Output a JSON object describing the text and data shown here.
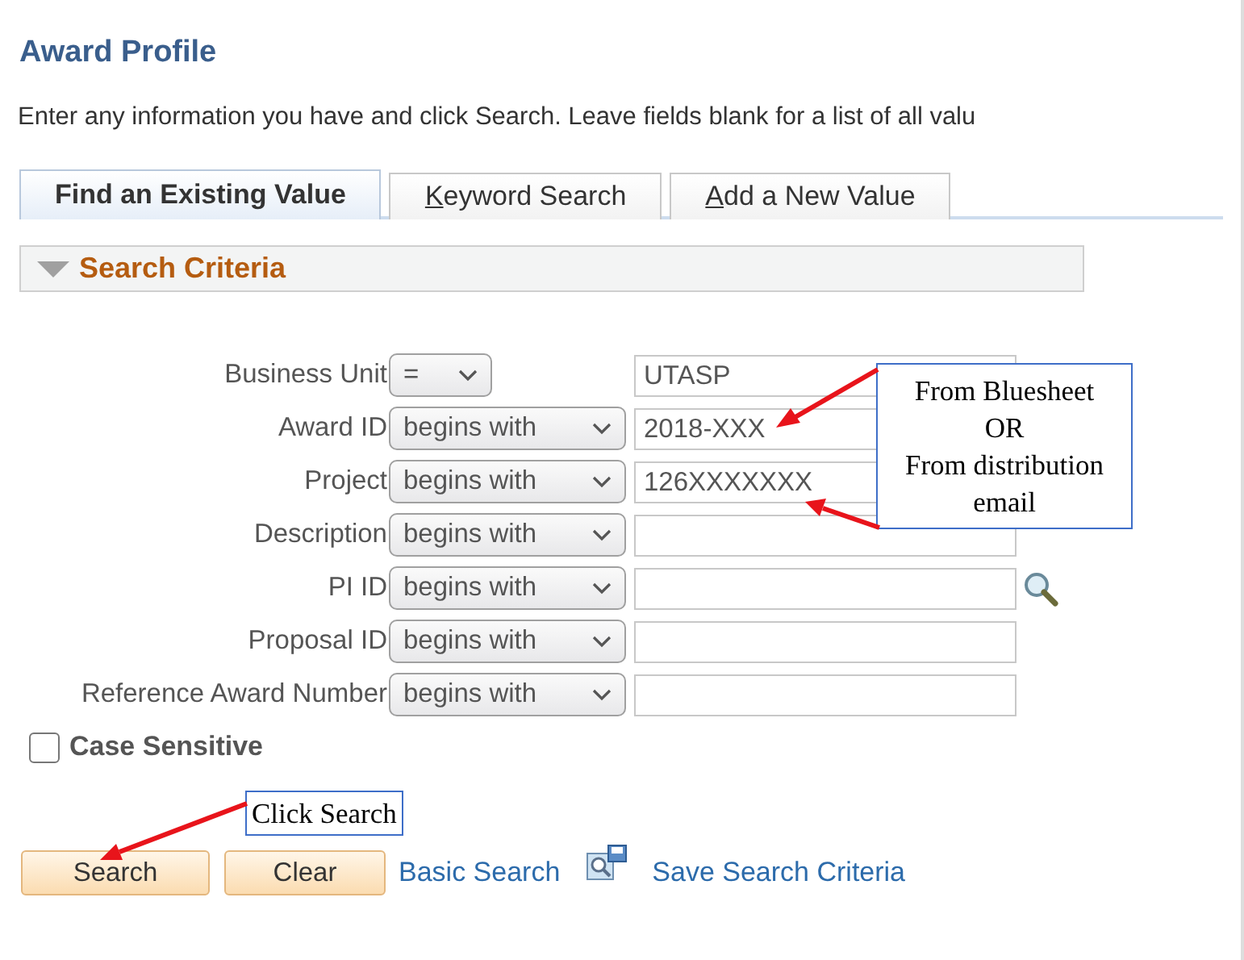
{
  "page": {
    "title": "Award Profile",
    "instructions": "Enter any information you have and click Search. Leave fields blank for a list of all valu"
  },
  "tabs": [
    {
      "label": "Find an Existing Value",
      "selected": true,
      "access_key_underlined": false
    },
    {
      "label": "Keyword Search",
      "selected": false,
      "access_key_underlined": true
    },
    {
      "label": "Add a New Value",
      "selected": false,
      "access_key_underlined": true
    }
  ],
  "section": {
    "title": "Search Criteria",
    "expanded": true
  },
  "fields": [
    {
      "label": "Business Unit",
      "operator": "=",
      "value": "UTASP",
      "narrow": true
    },
    {
      "label": "Award ID",
      "operator": "begins with",
      "value": "2018-XXX",
      "narrow": false
    },
    {
      "label": "Project",
      "operator": "begins with",
      "value": "126XXXXXXX",
      "narrow": false
    },
    {
      "label": "Description",
      "operator": "begins with",
      "narrow": false
    },
    {
      "label": "PI ID",
      "operator": "begins with",
      "lookup": true,
      "narrow": false
    },
    {
      "label": "Proposal ID",
      "operator": "begins with",
      "narrow": false
    },
    {
      "label": "Reference Award Number",
      "operator": "begins with",
      "narrow": false
    }
  ],
  "case_sensitive": {
    "label": "Case Sensitive",
    "checked": false
  },
  "buttons": [
    "Search",
    "Clear"
  ],
  "links": {
    "basic_search": "Basic Search",
    "save_criteria": "Save Search Criteria"
  },
  "annotations": [
    {
      "kind": "source",
      "lines": [
        "From Bluesheet",
        "OR",
        "From distribution",
        "email"
      ]
    },
    {
      "kind": "click",
      "lines": [
        "Click Search"
      ]
    }
  ]
}
